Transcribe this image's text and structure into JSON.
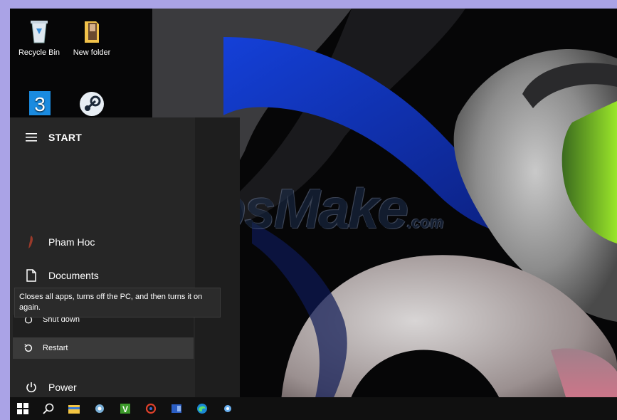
{
  "desktop": {
    "icons": [
      {
        "label": "Recycle Bin",
        "icon": "recycle-bin-icon"
      },
      {
        "label": "New folder",
        "icon": "folder-icon"
      },
      {
        "label": "",
        "icon": "app-3-icon"
      },
      {
        "label": "",
        "icon": "steam-icon"
      }
    ]
  },
  "watermark": {
    "text": "TipsMake",
    "domain": ".com"
  },
  "start_menu": {
    "title": "START",
    "user": "Pham Hoc",
    "documents": "Documents",
    "power": "Power",
    "power_menu": {
      "tooltip": "Closes all apps, turns off the PC, and then turns it on again.",
      "shutdown": "Shut down",
      "restart": "Restart"
    }
  },
  "taskbar": {
    "items": [
      "windows-start-icon",
      "search-icon",
      "file-explorer-icon",
      "app-icon",
      "vim-icon",
      "app-red-icon",
      "word-icon",
      "edge-icon",
      "app-blue-icon"
    ]
  },
  "colors": {
    "frame": "#aaa3e6",
    "wallpaper": "#070708",
    "start_bg": "#262626",
    "highlight": "#3a3a3a"
  }
}
